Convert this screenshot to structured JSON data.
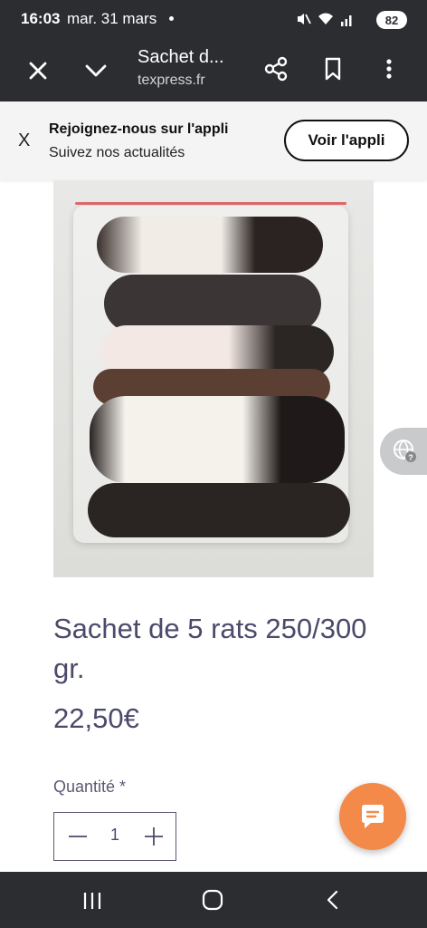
{
  "status_bar": {
    "time": "16:03",
    "date": "mar. 31 mars",
    "battery": "82",
    "icons": [
      "mute-icon",
      "wifi-icon",
      "signal-icon"
    ]
  },
  "custom_tab": {
    "title": "Sachet d...",
    "url": "texpress.fr",
    "icons": [
      "close-icon",
      "chevron-down-icon",
      "share-icon",
      "bookmark-icon",
      "more-vert-icon"
    ]
  },
  "app_banner": {
    "close_label": "X",
    "title": "Rejoignez-nous sur l'appli",
    "subtitle": "Suivez nos actualités",
    "button_label": "Voir l'appli"
  },
  "product": {
    "title": "Sachet de 5 rats 250/300 gr.",
    "price": "22,50€",
    "quantity_label": "Quantité *",
    "quantity_value": "1"
  },
  "colors": {
    "chrome": "#2b2d30",
    "banner_bg": "#f4f4f4",
    "text_primary": "#4b4a6b",
    "chat_fab": "#f38a4a"
  },
  "floating": {
    "translate_icon": "globe-question-icon",
    "chat_icon": "chat-bubble-icon"
  }
}
